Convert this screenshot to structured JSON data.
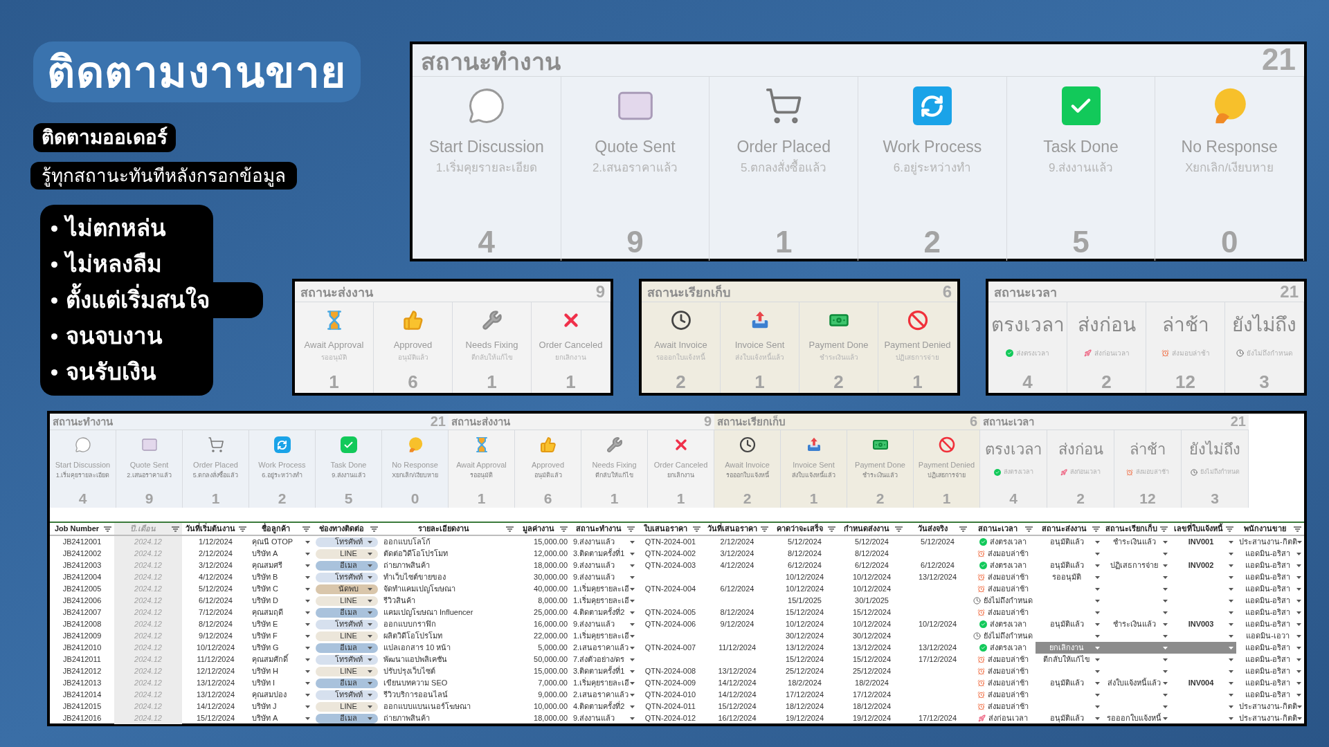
{
  "hero": {
    "title": "ติดตามงานขาย",
    "tags": [
      "ติดตามออเดอร์",
      "รู้ทุกสถานะทันทีหลังกรอกข้อมูล"
    ],
    "bullets": [
      "ไม่ตกหล่น",
      "ไม่หลงลืม",
      "ตั้งแต่เริ่มสนใจ",
      "จนจบงาน",
      "จนรับเงิน"
    ]
  },
  "dashboard": {
    "groups": [
      {
        "kind": "work",
        "title": "สถานะทำงาน",
        "total": "21",
        "items": [
          {
            "label": "Start Discussion",
            "sub": "1.เริ่มคุยรายละเอียด",
            "count": "4"
          },
          {
            "label": "Quote Sent",
            "sub": "2.เสนอราคาแล้ว",
            "count": "9"
          },
          {
            "label": "Order Placed",
            "sub": "5.ตกลงสั่งซื้อแล้ว",
            "count": "1"
          },
          {
            "label": "Work Process",
            "sub": "6.อยู่ระหว่างทำ",
            "count": "2"
          },
          {
            "label": "Task Done",
            "sub": "9.ส่งงานแล้ว",
            "count": "5"
          },
          {
            "label": "No Response",
            "sub": "Xยกเลิก/เงียบหาย",
            "count": "0"
          }
        ]
      },
      {
        "kind": "delivery",
        "title": "สถานะส่งงาน",
        "total": "9",
        "items": [
          {
            "label": "Await Approval",
            "sub": "รออนุมัติ",
            "count": "1"
          },
          {
            "label": "Approved",
            "sub": "อนุมัติแล้ว",
            "count": "6"
          },
          {
            "label": "Needs Fixing",
            "sub": "ตีกลับให้แก้ไข",
            "count": "1"
          },
          {
            "label": "Order Canceled",
            "sub": "ยกเลิกงาน",
            "count": "1"
          }
        ]
      },
      {
        "kind": "billing",
        "title": "สถานะเรียกเก็บ",
        "total": "6",
        "items": [
          {
            "label": "Await Invoice",
            "sub": "รอออกใบแจ้งหนี้",
            "count": "2"
          },
          {
            "label": "Invoice Sent",
            "sub": "ส่งใบแจ้งหนี้แล้ว",
            "count": "1"
          },
          {
            "label": "Payment Done",
            "sub": "ชำระเงินแล้ว",
            "count": "2"
          },
          {
            "label": "Payment Denied",
            "sub": "ปฏิเสธการจ่าย",
            "count": "1"
          }
        ]
      },
      {
        "kind": "time",
        "title": "สถานะเวลา",
        "total": "21",
        "items": [
          {
            "kind": "on_time",
            "label": "ตรงเวลา",
            "sub": "ส่งตรงเวลา",
            "count": "4"
          },
          {
            "kind": "early",
            "label": "ส่งก่อน",
            "sub": "ส่งก่อนเวลา",
            "count": "2"
          },
          {
            "kind": "late",
            "label": "ล่าช้า",
            "sub": "ส่งมอบล่าช้า",
            "count": "12"
          },
          {
            "kind": "pending",
            "label": "ยังไม่ถึง",
            "sub": "ยังไม่ถึงกำหนด",
            "count": "3"
          }
        ]
      }
    ]
  },
  "sheet": {
    "summary": [
      {
        "kind": "work",
        "title": "สถานะทำงาน",
        "total": "21",
        "items": [
          {
            "label": "Start Discussion",
            "sub": "1.เริ่มคุยรายละเอียด",
            "count": "4"
          },
          {
            "label": "Quote Sent",
            "sub": "2.เสนอราคาแล้ว",
            "count": "9"
          },
          {
            "label": "Order Placed",
            "sub": "5.ตกลงสั่งซื้อแล้ว",
            "count": "1"
          },
          {
            "label": "Work Process",
            "sub": "6.อยู่ระหว่างทำ",
            "count": "2"
          },
          {
            "label": "Task Done",
            "sub": "9.ส่งงานแล้ว",
            "count": "5"
          },
          {
            "label": "No Response",
            "sub": "Xยกเลิก/เงียบหาย",
            "count": "0"
          }
        ]
      },
      {
        "kind": "delivery",
        "title": "สถานะส่งงาน",
        "total": "9",
        "items": [
          {
            "label": "Await Approval",
            "sub": "รออนุมัติ",
            "count": "1"
          },
          {
            "label": "Approved",
            "sub": "อนุมัติแล้ว",
            "count": "6"
          },
          {
            "label": "Needs Fixing",
            "sub": "ตีกลับให้แก้ไข",
            "count": "1"
          },
          {
            "label": "Order Canceled",
            "sub": "ยกเลิกงาน",
            "count": "1"
          }
        ]
      },
      {
        "kind": "billing",
        "title": "สถานะเรียกเก็บ",
        "total": "6",
        "items": [
          {
            "label": "Await Invoice",
            "sub": "รอออกใบแจ้งหนี้",
            "count": "2"
          },
          {
            "label": "Invoice Sent",
            "sub": "ส่งใบแจ้งหนี้แล้ว",
            "count": "1"
          },
          {
            "label": "Payment Done",
            "sub": "ชำระเงินแล้ว",
            "count": "2"
          },
          {
            "label": "Payment Denied",
            "sub": "ปฏิเสธการจ่าย",
            "count": "1"
          }
        ]
      },
      {
        "kind": "time",
        "title": "สถานะเวลา",
        "total": "21",
        "items": [
          {
            "kind": "on_time",
            "label": "ตรงเวลา",
            "sub": "ส่งตรงเวลา",
            "count": "4"
          },
          {
            "kind": "early",
            "label": "ส่งก่อน",
            "sub": "ส่งก่อนเวลา",
            "count": "2"
          },
          {
            "kind": "late",
            "label": "ล่าช้า",
            "sub": "ส่งมอบล่าช้า",
            "count": "12"
          },
          {
            "kind": "pending",
            "label": "ยังไม่ถึง",
            "sub": "ยังไม่ถึงกำหนด",
            "count": "3"
          }
        ]
      }
    ],
    "columns": [
      "Job Number",
      "ปี.เดือน",
      "วันที่เริ่มต้นงาน",
      "ชื่อลูกค้า",
      "ช่องทางติดต่อ",
      "รายละเอียดงาน",
      "มูลค่างาน",
      "สถานะทำงาน",
      "ใบเสนอราคา",
      "วันที่เสนอราคา",
      "คาดว่าจะเสร็จ",
      "กำหนดส่งงาน",
      "วันส่งจริง",
      "สถานะเวลา",
      "สถานะส่งงาน",
      "สถานะเรียกเก็บ",
      "เลขที่ใบแจ้งหนี้",
      "พนักงานขาย"
    ],
    "rows": [
      {
        "job": "JB2412001",
        "month": "2024.12",
        "start": "1/12/2024",
        "customer": "คุณนี OTOP",
        "channel": {
          "label": "โทรศัพท์",
          "color": "#d6e0ee"
        },
        "detail": "ออกแบบโลโก้",
        "value": "15,000.00",
        "status": "9.ส่งงานแล้ว",
        "quote": "QTN-2024-001",
        "quote_date": "2/12/2024",
        "expected": "5/12/2024",
        "due": "5/12/2024",
        "delivered": "5/12/2024",
        "time": {
          "kind": "on_time",
          "label": "ส่งตรงเวลา"
        },
        "delivery": "อนุมัติแล้ว",
        "billing": "ชำระเงินแล้ว",
        "invoice": "INV001",
        "sales": "ประสานงาน-กิตติ",
        "cancelled": false
      },
      {
        "job": "JB2412002",
        "month": "2024.12",
        "start": "2/12/2024",
        "customer": "บริษัท A",
        "channel": {
          "label": "LINE",
          "color": "#ece6da"
        },
        "detail": "ตัดต่อวิดีโอโปรโมท",
        "value": "12,000.00",
        "status": "3.ติดตามครั้งที่1",
        "quote": "QTN-2024-002",
        "quote_date": "3/12/2024",
        "expected": "8/12/2024",
        "due": "8/12/2024",
        "time": {
          "kind": "late",
          "label": "ส่งมอบล่าช้า"
        },
        "sales": "แอดมิน-อริสา",
        "cancelled": false
      },
      {
        "job": "JB2412003",
        "month": "2024.12",
        "start": "3/12/2024",
        "customer": "คุณสมศรี",
        "channel": {
          "label": "อีเมล",
          "color": "#a9c2dc"
        },
        "detail": "ถ่ายภาพสินค้า",
        "value": "18,000.00",
        "status": "9.ส่งงานแล้ว",
        "quote": "QTN-2024-003",
        "quote_date": "4/12/2024",
        "expected": "6/12/2024",
        "due": "6/12/2024",
        "delivered": "6/12/2024",
        "time": {
          "kind": "on_time",
          "label": "ส่งตรงเวลา"
        },
        "delivery": "อนุมัติแล้ว",
        "billing": "ปฏิเสธการจ่าย",
        "invoice": "INV002",
        "sales": "แอดมิน-อริสา",
        "cancelled": false
      },
      {
        "job": "JB2412004",
        "month": "2024.12",
        "start": "4/12/2024",
        "customer": "บริษัท B",
        "channel": {
          "label": "โทรศัพท์",
          "color": "#d6e0ee"
        },
        "detail": "ทำเว็บไซต์ขายของ",
        "value": "30,000.00",
        "status": "9.ส่งงานแล้ว",
        "expected": "10/12/2024",
        "due": "10/12/2024",
        "delivered": "13/12/2024",
        "time": {
          "kind": "late",
          "label": "ส่งมอบล่าช้า"
        },
        "delivery": "รออนุมัติ",
        "sales": "แอดมิน-อริสา",
        "cancelled": false
      },
      {
        "job": "JB2412005",
        "month": "2024.12",
        "start": "5/12/2024",
        "customer": "บริษัท C",
        "channel": {
          "label": "นัดพบ",
          "color": "#d9c6ab"
        },
        "detail": "จัดทำแคมเปญโฆษณา",
        "value": "40,000.00",
        "status": "1.เริ่มคุยรายละเอี",
        "quote": "QTN-2024-004",
        "quote_date": "6/12/2024",
        "expected": "10/12/2024",
        "due": "10/12/2024",
        "time": {
          "kind": "late",
          "label": "ส่งมอบล่าช้า"
        },
        "sales": "แอดมิน-อริสา",
        "cancelled": false
      },
      {
        "job": "JB2412006",
        "month": "2024.12",
        "start": "6/12/2024",
        "customer": "บริษัท D",
        "channel": {
          "label": "LINE",
          "color": "#ece6da"
        },
        "detail": "รีวิวสินค้า",
        "value": "8,000.00",
        "status": "1.เริ่มคุยรายละเอี",
        "expected": "15/1/2025",
        "due": "30/1/2025",
        "time": {
          "kind": "pending",
          "label": "ยังไม่ถึงกำหนด"
        },
        "sales": "แอดมิน-อริสา",
        "cancelled": false
      },
      {
        "job": "JB2412007",
        "month": "2024.12",
        "start": "7/12/2024",
        "customer": "คุณสมฤดี",
        "channel": {
          "label": "อีเมล",
          "color": "#a9c2dc"
        },
        "detail": "แคมเปญโฆษณา Influencer",
        "value": "25,000.00",
        "status": "4.ติดตามครั้งที่2",
        "quote": "QTN-2024-005",
        "quote_date": "8/12/2024",
        "expected": "15/12/2024",
        "due": "15/12/2024",
        "time": {
          "kind": "late",
          "label": "ส่งมอบล่าช้า"
        },
        "sales": "แอดมิน-อริสา",
        "cancelled": false
      },
      {
        "job": "JB2412008",
        "month": "2024.12",
        "start": "8/12/2024",
        "customer": "บริษัท E",
        "channel": {
          "label": "โทรศัพท์",
          "color": "#d6e0ee"
        },
        "detail": "ออกแบบกราฟิก",
        "value": "16,000.00",
        "status": "9.ส่งงานแล้ว",
        "quote": "QTN-2024-006",
        "quote_date": "9/12/2024",
        "expected": "10/12/2024",
        "due": "10/12/2024",
        "delivered": "10/12/2024",
        "time": {
          "kind": "on_time",
          "label": "ส่งตรงเวลา"
        },
        "delivery": "อนุมัติแล้ว",
        "billing": "ชำระเงินแล้ว",
        "invoice": "INV003",
        "sales": "แอดมิน-อริสา",
        "cancelled": false
      },
      {
        "job": "JB2412009",
        "month": "2024.12",
        "start": "9/12/2024",
        "customer": "บริษัท F",
        "channel": {
          "label": "LINE",
          "color": "#ece6da"
        },
        "detail": "ผลิตวิดีโอโปรโมท",
        "value": "22,000.00",
        "status": "1.เริ่มคุยรายละเอี",
        "expected": "30/12/2024",
        "due": "30/12/2024",
        "time": {
          "kind": "pending",
          "label": "ยังไม่ถึงกำหนด"
        },
        "sales": "แอดมิน-เอวา",
        "cancelled": false
      },
      {
        "job": "JB2412010",
        "month": "2024.12",
        "start": "10/12/2024",
        "customer": "บริษัท G",
        "channel": {
          "label": "อีเมล",
          "color": "#a9c2dc"
        },
        "detail": "แปลเอกสาร 10 หน้า",
        "value": "5,000.00",
        "status": "2.เสนอราคาแล้ว",
        "quote": "QTN-2024-007",
        "quote_date": "11/12/2024",
        "expected": "13/12/2024",
        "due": "13/12/2024",
        "delivered": "13/12/2024",
        "time": {
          "kind": "on_time",
          "label": "ส่งตรงเวลา"
        },
        "delivery": "ยกเลิกงาน",
        "sales": "แอดมิน-อริสา",
        "cancelled": true
      },
      {
        "job": "JB2412011",
        "month": "2024.12",
        "start": "11/12/2024",
        "customer": "คุณสมศักดิ์",
        "channel": {
          "label": "โทรศัพท์",
          "color": "#d6e0ee"
        },
        "detail": "พัฒนาแอปพลิเคชัน",
        "value": "50,000.00",
        "status": "7.ส่งตัวอย่าง/ดร",
        "expected": "15/12/2024",
        "due": "15/12/2024",
        "delivered": "17/12/2024",
        "time": {
          "kind": "late",
          "label": "ส่งมอบล่าช้า"
        },
        "delivery": "ตีกลับให้แก้ไข",
        "sales": "แอดมิน-อริสา",
        "cancelled": false
      },
      {
        "job": "JB2412012",
        "month": "2024.12",
        "start": "12/12/2024",
        "customer": "บริษัท H",
        "channel": {
          "label": "LINE",
          "color": "#ece6da"
        },
        "detail": "ปรับปรุงเว็บไซต์",
        "value": "15,000.00",
        "status": "3.ติดตามครั้งที่1",
        "quote": "QTN-2024-008",
        "quote_date": "13/12/2024",
        "expected": "25/12/2024",
        "due": "25/12/2024",
        "time": {
          "kind": "late",
          "label": "ส่งมอบล่าช้า"
        },
        "sales": "แอดมิน-อริสา",
        "cancelled": false
      },
      {
        "job": "JB2412013",
        "month": "2024.12",
        "start": "13/12/2024",
        "customer": "บริษัท I",
        "channel": {
          "label": "อีเมล",
          "color": "#a9c2dc"
        },
        "detail": "เขียนบทความ SEO",
        "value": "7,000.00",
        "status": "1.เริ่มคุยรายละเอี",
        "quote": "QTN-2024-009",
        "quote_date": "14/12/2024",
        "expected": "18/2/2024",
        "due": "18/2/2024",
        "time": {
          "kind": "late",
          "label": "ส่งมอบล่าช้า"
        },
        "delivery": "อนุมัติแล้ว",
        "billing": "ส่งใบแจ้งหนี้แล้ว",
        "invoice": "INV004",
        "sales": "แอดมิน-อริสา",
        "cancelled": false
      },
      {
        "job": "JB2412014",
        "month": "2024.12",
        "start": "13/12/2024",
        "customer": "คุณสมปอง",
        "channel": {
          "label": "โทรศัพท์",
          "color": "#d6e0ee"
        },
        "detail": "รีวิวบริการออนไลน์",
        "value": "9,000.00",
        "status": "2.เสนอราคาแล้ว",
        "quote": "QTN-2024-010",
        "quote_date": "14/12/2024",
        "expected": "17/12/2024",
        "due": "17/12/2024",
        "time": {
          "kind": "late",
          "label": "ส่งมอบล่าช้า"
        },
        "sales": "แอดมิน-อริสา",
        "cancelled": false
      },
      {
        "job": "JB2412015",
        "month": "2024.12",
        "start": "14/12/2024",
        "customer": "บริษัท J",
        "channel": {
          "label": "LINE",
          "color": "#ece6da"
        },
        "detail": "ออกแบบแบนเนอร์โฆษณา",
        "value": "10,000.00",
        "status": "4.ติดตามครั้งที่2",
        "quote": "QTN-2024-011",
        "quote_date": "15/12/2024",
        "expected": "18/12/2024",
        "due": "18/12/2024",
        "time": {
          "kind": "late",
          "label": "ส่งมอบล่าช้า"
        },
        "sales": "ประสานงาน-กิตติ",
        "cancelled": false
      },
      {
        "job": "JB2412016",
        "month": "2024.12",
        "start": "15/12/2024",
        "customer": "บริษัท A",
        "channel": {
          "label": "อีเมล",
          "color": "#a9c2dc"
        },
        "detail": "ถ่ายภาพสินค้า",
        "value": "18,000.00",
        "status": "9.ส่งงานแล้ว",
        "quote": "QTN-2024-012",
        "quote_date": "16/12/2024",
        "expected": "19/12/2024",
        "due": "19/12/2024",
        "delivered": "17/12/2024",
        "time": {
          "kind": "early",
          "label": "ส่งก่อนเวลา"
        },
        "delivery": "อนุมัติแล้ว",
        "billing": "รอออกใบแจ้งหนี้",
        "sales": "ประสานงาน-กิตติ",
        "cancelled": false
      }
    ]
  }
}
